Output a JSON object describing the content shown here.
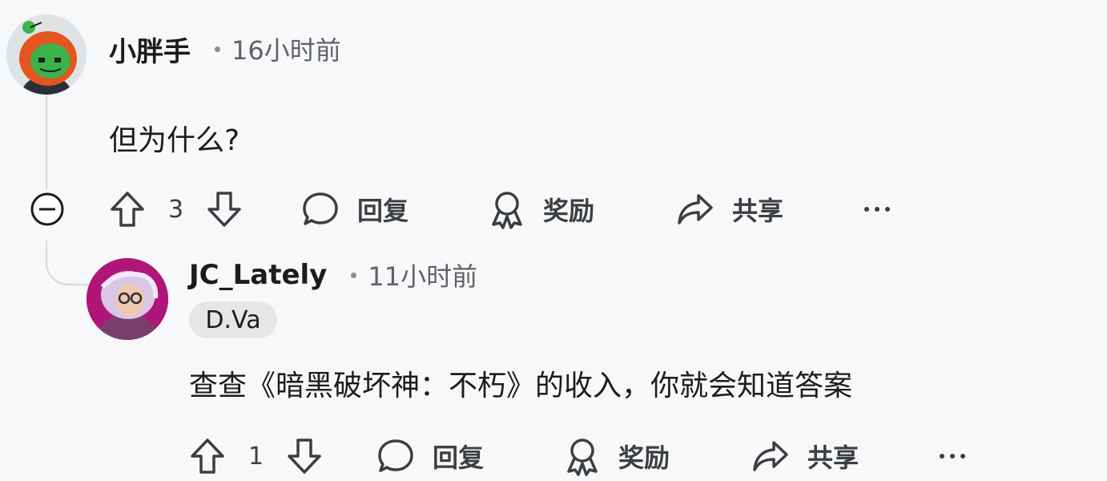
{
  "comments": [
    {
      "username": "小胖手",
      "timestamp": "16小时前",
      "body": "但为什么?",
      "vote_count": "3",
      "actions": {
        "reply": "回复",
        "award": "奖励",
        "share": "共享",
        "more": "···"
      }
    },
    {
      "username": "JC_Lately",
      "timestamp": "11小时前",
      "flair": "D.Va",
      "body": "查查《暗黑破坏神：不朽》的收入，你就会知道答案",
      "vote_count": "1",
      "actions": {
        "reply": "回复",
        "award": "奖励",
        "share": "共享",
        "more": "···"
      }
    }
  ],
  "icons": {
    "upvote": "upvote-arrow-icon",
    "downvote": "downvote-arrow-icon",
    "reply": "speech-bubble-icon",
    "award": "award-ribbon-icon",
    "share": "share-arrow-icon",
    "more": "more-dots-icon",
    "collapse": "collapse-minus-icon"
  },
  "colors": {
    "background": "#f7f8f9",
    "text": "#1c1c1c",
    "muted": "#5f6368",
    "thread_line": "#d5d7d9",
    "flair_bg": "#e4e6e8"
  }
}
